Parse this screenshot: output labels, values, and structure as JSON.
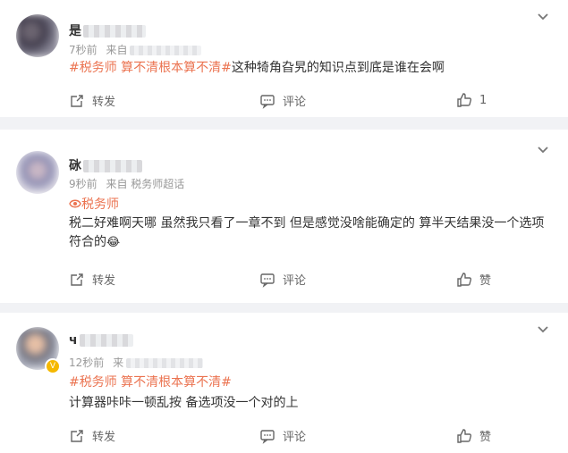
{
  "comments": [
    {
      "name": "是",
      "time": "7秒前",
      "source_prefix": "来自",
      "tags": "#税务师 算不清根本算不清#",
      "text": "这种犄角旮旯的知识点到底是谁在会啊",
      "repost_label": "转发",
      "comment_label": "评论",
      "like_label": "1"
    },
    {
      "name": "砯",
      "time": "9秒前",
      "source": "来自 税务师超话",
      "topic": "税务师",
      "text": "税二好难啊天哪 虽然我只看了一章不到 但是感觉没啥能确定的 算半天结果没一个选项符合的",
      "emoji": "😂",
      "repost_label": "转发",
      "comment_label": "评论",
      "like_label": "赞"
    },
    {
      "name": "ч",
      "time": "12秒前",
      "source_prefix": "来",
      "tags": "#税务师 算不清根本算不清#",
      "text": "计算器咔咔一顿乱按 备选项没一个对的上",
      "badge": "V",
      "repost_label": "转发",
      "comment_label": "评论",
      "like_label": "赞"
    }
  ],
  "colors": {
    "accent": "#eb7350",
    "meta": "#999999",
    "background": "#f1f2f5"
  }
}
